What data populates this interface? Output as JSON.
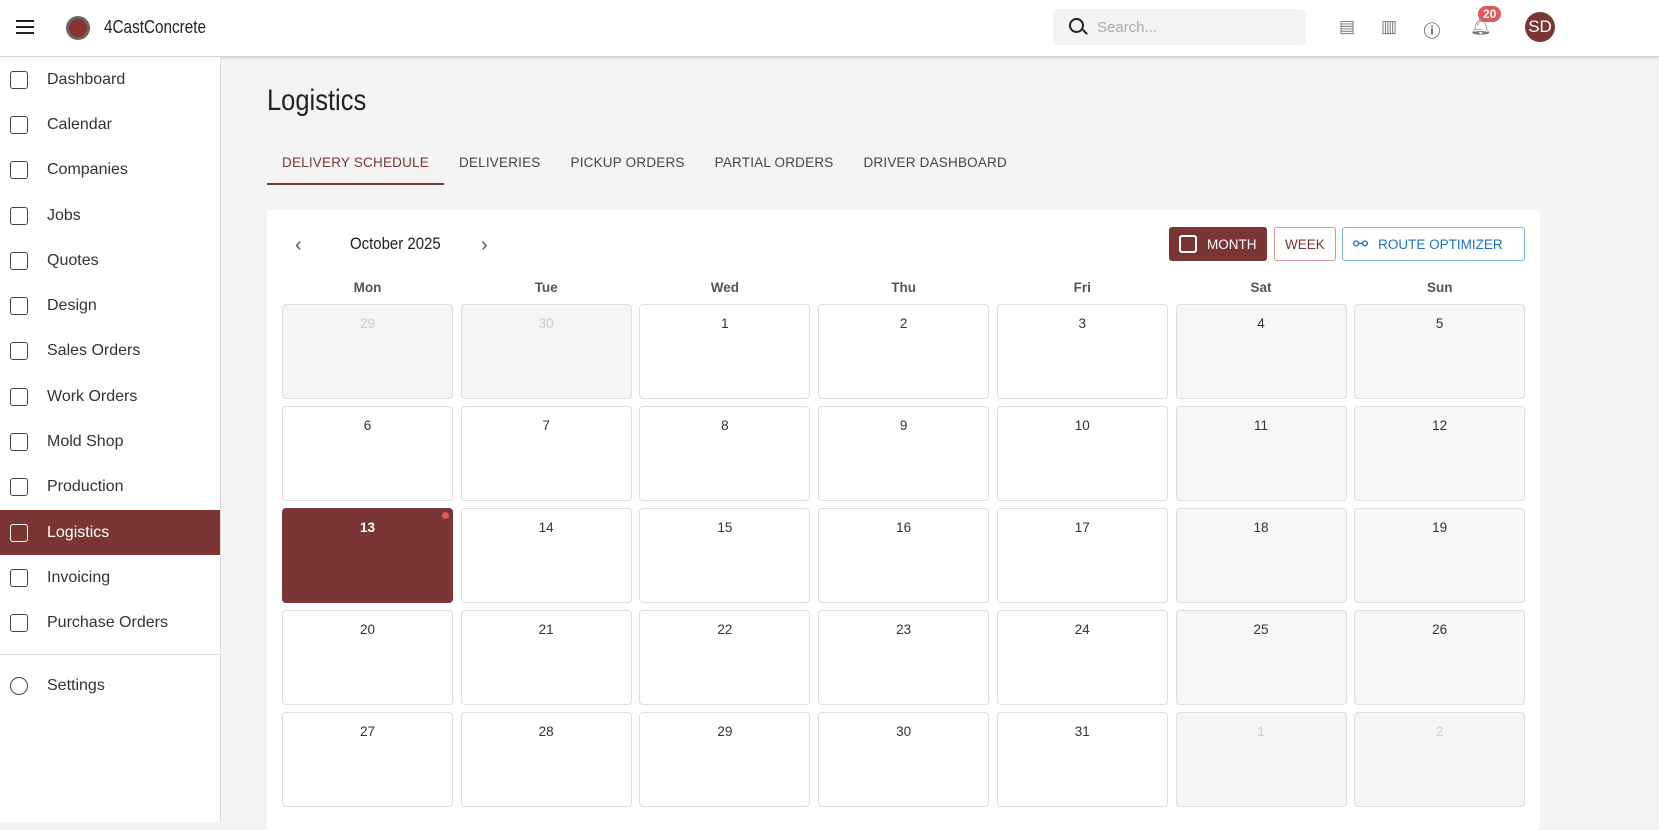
{
  "app": {
    "name": "4CastConcrete",
    "logo_text": "4CAST"
  },
  "header": {
    "search_placeholder": "Search...",
    "icons": [
      "document-icon",
      "factory-icon",
      "help-icon",
      "bell-icon"
    ],
    "notification_count": "20",
    "avatar_initials": "SD"
  },
  "sidebar": {
    "items": [
      {
        "label": "Dashboard",
        "icon": "dashboard-icon"
      },
      {
        "label": "Calendar",
        "icon": "calendar-icon"
      },
      {
        "label": "Companies",
        "icon": "building-icon"
      },
      {
        "label": "Jobs",
        "icon": "briefcase-icon"
      },
      {
        "label": "Quotes",
        "icon": "document-icon"
      },
      {
        "label": "Design",
        "icon": "pen-icon"
      },
      {
        "label": "Sales Orders",
        "icon": "cart-icon"
      },
      {
        "label": "Work Orders",
        "icon": "clipboard-icon"
      },
      {
        "label": "Mold Shop",
        "icon": "wrench-icon"
      },
      {
        "label": "Production",
        "icon": "factory-icon"
      },
      {
        "label": "Logistics",
        "icon": "truck-icon",
        "active": true
      },
      {
        "label": "Invoicing",
        "icon": "dollar-icon"
      },
      {
        "label": "Purchase Orders",
        "icon": "box-icon"
      }
    ],
    "settings": {
      "label": "Settings",
      "icon": "gear-icon"
    }
  },
  "page": {
    "title": "Logistics",
    "tabs": [
      {
        "label": "DELIVERY SCHEDULE",
        "active": true
      },
      {
        "label": "DELIVERIES"
      },
      {
        "label": "PICKUP ORDERS"
      },
      {
        "label": "PARTIAL ORDERS"
      },
      {
        "label": "DRIVER DASHBOARD"
      }
    ]
  },
  "calendar": {
    "month_label": "October 2025",
    "view_buttons": {
      "month": "MONTH",
      "week": "WEEK",
      "route": "ROUTE OPTIMIZER"
    },
    "active_view": "month",
    "weekdays": [
      "Mon",
      "Tue",
      "Wed",
      "Thu",
      "Fri",
      "Sat",
      "Sun"
    ],
    "weeks": [
      [
        {
          "d": "29",
          "m": 1
        },
        {
          "d": "30",
          "m": 1
        },
        {
          "d": "1"
        },
        {
          "d": "2"
        },
        {
          "d": "3"
        },
        {
          "d": "4"
        },
        {
          "d": "5"
        }
      ],
      [
        {
          "d": "6"
        },
        {
          "d": "7"
        },
        {
          "d": "8"
        },
        {
          "d": "9"
        },
        {
          "d": "10"
        },
        {
          "d": "11"
        },
        {
          "d": "12"
        }
      ],
      [
        {
          "d": "13",
          "today": 1,
          "event": 1
        },
        {
          "d": "14"
        },
        {
          "d": "15"
        },
        {
          "d": "16"
        },
        {
          "d": "17"
        },
        {
          "d": "18"
        },
        {
          "d": "19"
        }
      ],
      [
        {
          "d": "20"
        },
        {
          "d": "21"
        },
        {
          "d": "22"
        },
        {
          "d": "23"
        },
        {
          "d": "24"
        },
        {
          "d": "25"
        },
        {
          "d": "26"
        }
      ],
      [
        {
          "d": "27"
        },
        {
          "d": "28"
        },
        {
          "d": "29"
        },
        {
          "d": "30"
        },
        {
          "d": "31"
        },
        {
          "d": "1",
          "m": 1
        },
        {
          "d": "2",
          "m": 1
        }
      ]
    ]
  },
  "colors": {
    "accent": "#7b3535",
    "event_dot": "#e05a5a",
    "route_blue": "#1a73c8"
  }
}
